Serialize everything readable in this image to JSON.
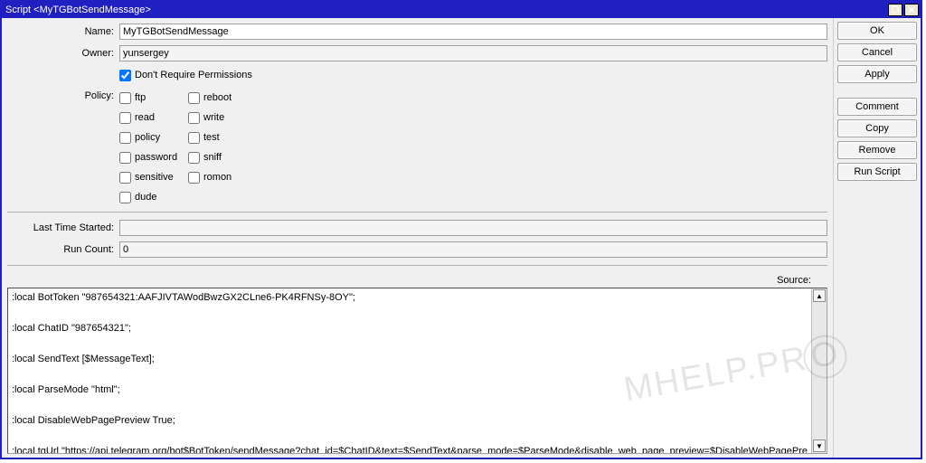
{
  "window": {
    "title": "Script <MyTGBotSendMessage>"
  },
  "sysbtns": {
    "max": "❐",
    "close": "✕"
  },
  "fields": {
    "name_label": "Name:",
    "name_value": "MyTGBotSendMessage",
    "owner_label": "Owner:",
    "owner_value": "yunsergey",
    "dont_require_label": "Don't Require Permissions",
    "policy_label": "Policy:",
    "last_time_label": "Last Time Started:",
    "last_time_value": "",
    "run_count_label": "Run Count:",
    "run_count_value": "0",
    "source_label": "Source:"
  },
  "policy": {
    "ftp": "ftp",
    "reboot": "reboot",
    "read": "read",
    "write": "write",
    "policy": "policy",
    "test": "test",
    "password": "password",
    "sniff": "sniff",
    "sensitive": "sensitive",
    "romon": "romon",
    "dude": "dude"
  },
  "buttons": {
    "ok": "OK",
    "cancel": "Cancel",
    "apply": "Apply",
    "comment": "Comment",
    "copy": "Copy",
    "remove": "Remove",
    "run_script": "Run Script"
  },
  "source_text": ":local BotToken \"987654321:AAFJIVTAWodBwzGX2CLne6-PK4RFNSy-8OY\";\n\n:local ChatID \"987654321\";\n\n:local SendText [$MessageText];\n\n:local ParseMode \"html\";\n\n:local DisableWebPagePreview True;\n\n:local tgUrl \"https://api.telegram.org/bot$BotToken/sendMessage?chat_id=$ChatID&text=$SendText&parse_mode=$ParseMode&disable_web_page_preview=$DisableWebPagePreview\";",
  "watermark": "MHELP.PR"
}
